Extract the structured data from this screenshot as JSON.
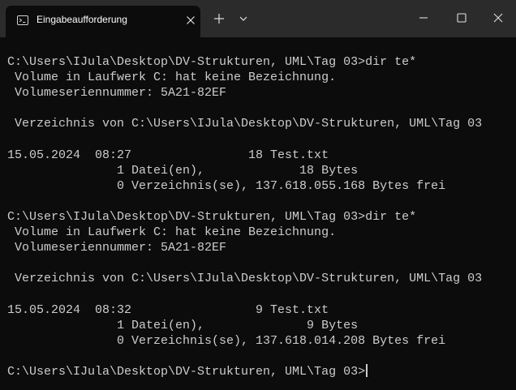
{
  "window": {
    "tab_title": "Eingabeaufforderung",
    "tab_icon": "terminal-icon",
    "controls": [
      "close-icon",
      "plus-icon",
      "chevron-down-icon",
      "minimize-icon",
      "maximize-icon",
      "close-icon"
    ]
  },
  "terminal": {
    "lines": [
      "",
      "C:\\Users\\IJula\\Desktop\\DV-Strukturen, UML\\Tag 03>dir te*",
      " Volume in Laufwerk C: hat keine Bezeichnung.",
      " Volumeseriennummer: 5A21-82EF",
      "",
      " Verzeichnis von C:\\Users\\IJula\\Desktop\\DV-Strukturen, UML\\Tag 03",
      "",
      "15.05.2024  08:27                18 Test.txt",
      "               1 Datei(en),             18 Bytes",
      "               0 Verzeichnis(se), 137.618.055.168 Bytes frei",
      "",
      "C:\\Users\\IJula\\Desktop\\DV-Strukturen, UML\\Tag 03>dir te*",
      " Volume in Laufwerk C: hat keine Bezeichnung.",
      " Volumeseriennummer: 5A21-82EF",
      "",
      " Verzeichnis von C:\\Users\\IJula\\Desktop\\DV-Strukturen, UML\\Tag 03",
      "",
      "15.05.2024  08:32                 9 Test.txt",
      "               1 Datei(en),              9 Bytes",
      "               0 Verzeichnis(se), 137.618.014.208 Bytes frei",
      ""
    ],
    "prompt": "C:\\Users\\IJula\\Desktop\\DV-Strukturen, UML\\Tag 03>"
  },
  "colors": {
    "background": "#0c0c0c",
    "titlebar": "#2b2b2b",
    "text": "#cccccc"
  }
}
